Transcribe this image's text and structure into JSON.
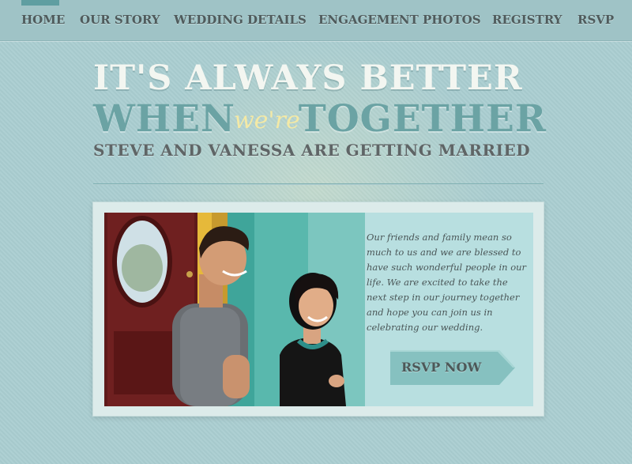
{
  "nav": {
    "items": [
      {
        "label": "HOME"
      },
      {
        "label": "OUR STORY"
      },
      {
        "label": "WEDDING DETAILS"
      },
      {
        "label": "ENGAGEMENT PHOTOS"
      },
      {
        "label": "REGISTRY"
      },
      {
        "label": "RSVP"
      }
    ],
    "active": "HOME"
  },
  "hero": {
    "line1": "IT'S ALWAYS BETTER",
    "line2_before": "WHEN",
    "line2_script": "we're",
    "line2_after": "TOGETHER",
    "subtitle": "STEVE AND VANESSA ARE GETTING MARRIED"
  },
  "card": {
    "message": "Our friends and family mean so much to us and we are blessed to have such wonderful people in our life. We are excited to take the next step in our journey together and hope you can join us in celebrating our wedding.",
    "rsvp_label": "RSVP NOW"
  },
  "colors": {
    "background": "#a9cdd0",
    "accent": "#6ba3a4",
    "script": "#f3e9a6",
    "text_dark": "#4f5b5c"
  }
}
